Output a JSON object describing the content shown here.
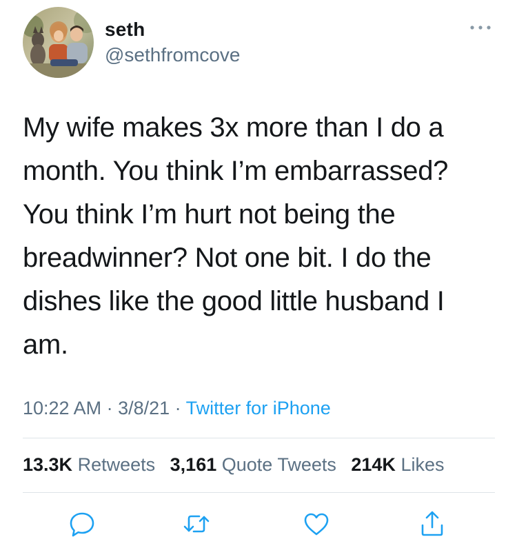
{
  "user": {
    "display_name": "seth",
    "handle": "@sethfromcove"
  },
  "tweet": {
    "text": "My wife makes 3x more than I do a\nmonth. You think I’m embarrassed?\nYou think I’m hurt not being the\nbreadwinner? Not one bit. I do the\ndishes like the good little husband I\nam."
  },
  "meta": {
    "time": "10:22 AM",
    "separator": " · ",
    "date": "3/8/21",
    "source": "Twitter for iPhone"
  },
  "stats": {
    "retweets": {
      "count": "13.3K",
      "label": "Retweets"
    },
    "quotes": {
      "count": "3,161",
      "label": "Quote Tweets"
    },
    "likes": {
      "count": "214K",
      "label": "Likes"
    }
  },
  "icons": {
    "more": "more-horizontal-icon",
    "reply": "comment-icon",
    "retweet": "retweet-icon",
    "like": "heart-icon",
    "share": "share-icon"
  },
  "colors": {
    "text": "#14171a",
    "secondary": "#5b7083",
    "link": "#1da1f2",
    "divider": "#dde3e8",
    "icon": "#1da1f2"
  }
}
